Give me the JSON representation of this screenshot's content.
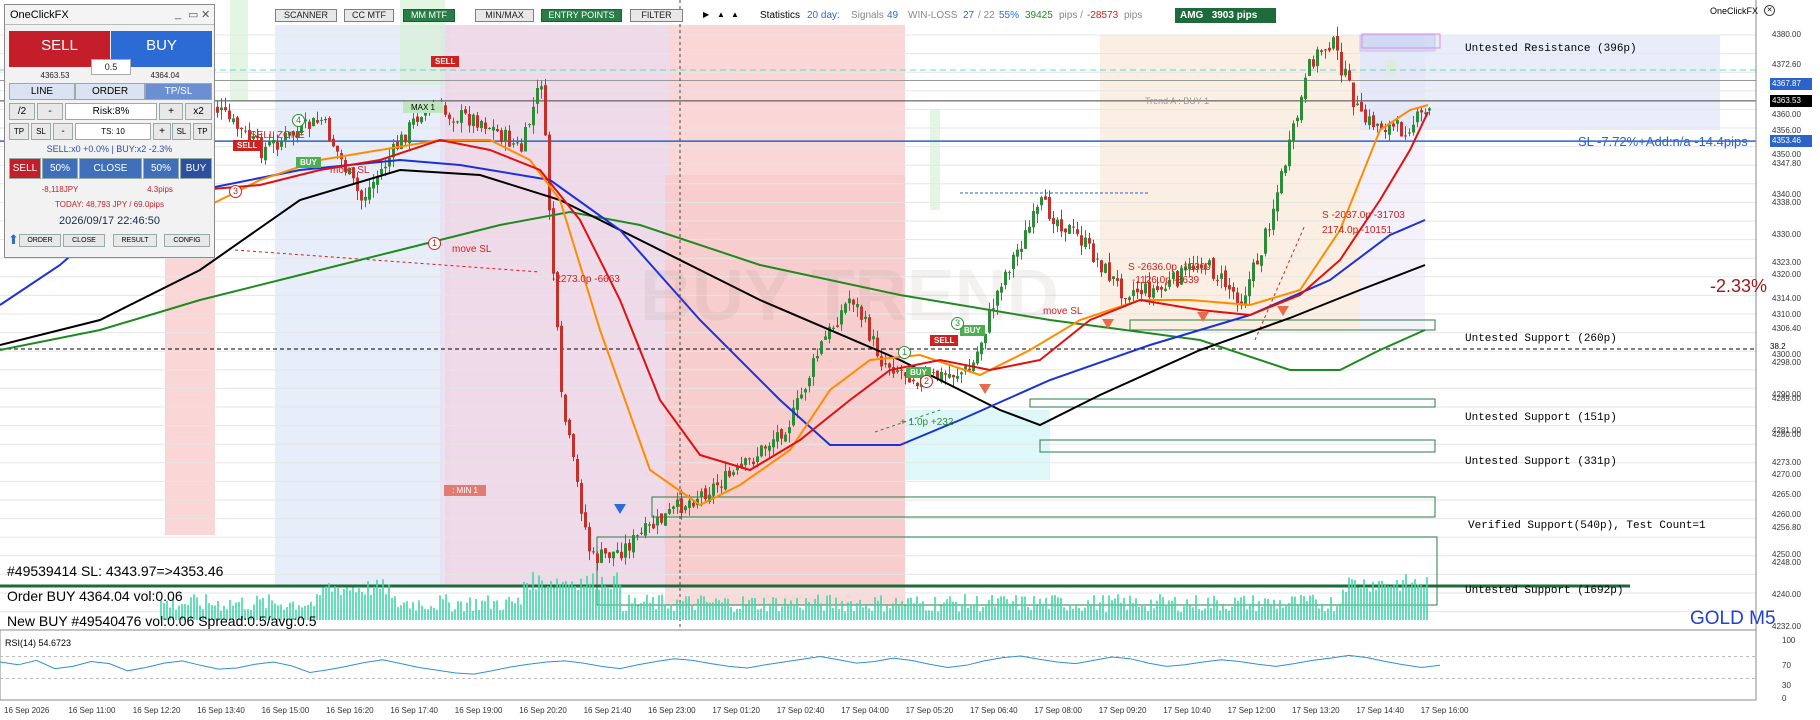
{
  "toolbar": {
    "buttons": [
      {
        "label": "SCANNER",
        "active": false
      },
      {
        "label": "CC MTF",
        "active": false
      },
      {
        "label": "MM MTF",
        "active": true
      },
      {
        "label": "MIN/MAX",
        "active": false
      },
      {
        "label": "ENTRY POINTS",
        "active": true
      },
      {
        "label": "FILTER",
        "active": false
      }
    ],
    "arrows": [
      "▶",
      "▲",
      "▲"
    ]
  },
  "stats": {
    "label": "Statistics",
    "days": "20 day:",
    "signals_label": "Signals",
    "signals": "49",
    "winloss_label": "WIN-LOSS",
    "win": "27",
    "loss": "/ 22",
    "pct": "55%",
    "pips_pos": "39425",
    "pips_label": "pips /",
    "pips_neg": "-28573",
    "pips_label2": "pips",
    "amg_label": "AMG",
    "amg_value": "3903 pips"
  },
  "brand": "OneClickFX",
  "panel": {
    "title": "OneClickFX",
    "controls": [
      "_",
      "▭",
      "✕"
    ],
    "sell_label": "SELL",
    "buy_label": "BUY",
    "spread": "0.5",
    "bid": "4363.53",
    "ask": "4364.04",
    "tabs": [
      "LINE",
      "ORDER",
      "TP/SL"
    ],
    "row1": [
      "/2",
      "-",
      "Risk:8%",
      "+",
      "x2"
    ],
    "row2": [
      "TP",
      "SL",
      "-",
      "TS: 10",
      "+",
      "SL",
      "TP"
    ],
    "position_info": "SELL:x0 +0.0% | BUY:x2 -2.3%",
    "close_row": [
      "SELL",
      "50%",
      "CLOSE",
      "50%",
      "BUY"
    ],
    "pnl_left": "-8,118JPY",
    "pnl_right": "4.3pips",
    "today": "TODAY: 48,793 JPY / 69.0pips",
    "datetime": "2026/09/17   22:46:50",
    "bottom_buttons": [
      "ORDER",
      "CLOSE",
      "RESULT",
      "CONFIG"
    ]
  },
  "zones": [
    {
      "label": "Untested Resistance (396p)"
    },
    {
      "label": "Untested Support (260p)"
    },
    {
      "label": "Untested Support (151p)"
    },
    {
      "label": "Untested Support (331p)"
    },
    {
      "label": "Verified Support(540p), Test Count=1"
    },
    {
      "label": "Untested Support (1692p)"
    }
  ],
  "annotations": {
    "sl_line": "SL -7.72%+Add:n/a -14.4pips",
    "pct_change": "-2.33%",
    "trend_text": "BUY TREND",
    "trend_line": "Trend A : BUY 1",
    "fib": "38.2",
    "max_label": "MAX 1",
    "min_label": ": MIN 1",
    "sell_zone": "SELL ZONE",
    "move_sl": "move SL",
    "move_sl_2": "move SL",
    "move_sl_3": "move SL",
    "trade1": "-2273.0p -6663",
    "trade2_a": "S -2636.0p -12309",
    "trade2_b": "-1126.0p -3639",
    "trade3_a": "S -2037.0p -31703",
    "trade3_b": "2174.0p -10151",
    "trade4": "+ 1.0p +232",
    "signals": [
      {
        "text": "SELL",
        "type": "sell"
      },
      {
        "text": "SELL",
        "type": "sell"
      },
      {
        "text": "BUY",
        "type": "buy"
      },
      {
        "text": "BUY",
        "type": "buy"
      },
      {
        "text": "BUY",
        "type": "buy"
      },
      {
        "text": "SELL",
        "type": "sell"
      }
    ],
    "circles": [
      "4",
      "3",
      "1",
      "1",
      "2",
      "3"
    ]
  },
  "messages": {
    "line1": "#49539414 SL: 4343.97=>4353.46",
    "line2": "Order BUY 4364.04 vol:0.06",
    "line3": "New BUY #49540476 vol:0.06 Spread:0.5/avg:0.5"
  },
  "symbol": "GOLD M5",
  "rsi": {
    "label": "RSI(14) 54.6723",
    "levels": [
      "100",
      "70",
      "30",
      "0"
    ],
    "values": [
      60,
      55,
      63,
      48,
      52,
      61,
      57,
      44,
      50,
      58,
      62,
      54,
      47,
      49,
      56,
      60,
      53,
      41,
      46,
      52,
      59,
      64,
      57,
      50,
      45,
      40,
      38,
      44,
      51,
      56,
      60,
      62,
      58,
      52,
      48,
      55,
      61,
      66,
      63,
      57,
      52,
      49,
      55,
      60,
      65,
      70,
      64,
      58,
      61,
      67,
      63,
      56,
      50,
      54,
      62,
      68,
      71,
      65,
      60,
      57,
      63,
      69,
      66,
      58,
      52,
      55,
      60,
      64,
      61,
      56,
      52,
      57,
      63,
      67,
      72,
      68,
      61,
      55,
      50,
      54
    ]
  },
  "price_axis": {
    "labels": [
      "4380.00",
      "4372.60",
      "4367.87",
      "4363.53",
      "4360.00",
      "4356.00",
      "4353.46",
      "4350.00",
      "4347.80",
      "4340.00",
      "4338.00",
      "4330.00",
      "4323.00",
      "4320.00",
      "4314.00",
      "4310.00",
      "4306.40",
      "4300.00",
      "4298.00",
      "4290.00",
      "4289.00",
      "4281.00",
      "4280.00",
      "4273.00",
      "4270.00",
      "4265.00",
      "4260.00",
      "4256.80",
      "4250.00",
      "4248.00",
      "4240.00",
      "4232.00"
    ],
    "highlights": [
      {
        "label": "4367.87",
        "color": "#2b63c9"
      },
      {
        "label": "4363.53",
        "color": "#000000"
      },
      {
        "label": "4353.46",
        "color": "#2b63c9"
      }
    ]
  },
  "time_axis": {
    "labels": [
      "16 Sep 2026",
      "16 Sep 11:00",
      "16 Sep 12:20",
      "16 Sep 13:40",
      "16 Sep 15:00",
      "16 Sep 16:20",
      "16 Sep 17:40",
      "16 Sep 19:00",
      "16 Sep 20:20",
      "16 Sep 21:40",
      "16 Sep 23:00",
      "17 Sep 01:20",
      "17 Sep 02:40",
      "17 Sep 04:00",
      "17 Sep 05:20",
      "17 Sep 06:40",
      "17 Sep 08:00",
      "17 Sep 09:20",
      "17 Sep 10:40",
      "17 Sep 12:00",
      "17 Sep 13:20",
      "17 Sep 14:40",
      "17 Sep 16:00"
    ]
  },
  "colors": {
    "sell": "#c41e2a",
    "buy": "#2c6ad6",
    "toolbar_active": "#2a7d46",
    "sl_line": "#2b63c9",
    "resistance": "#c0c9ef",
    "support": "#2a7d46",
    "candle_up": "#2e8b3a",
    "candle_down": "#c6302a",
    "ma_red": "#e01010",
    "ma_orange": "#ff8c00",
    "ma_blue": "#1a32d8",
    "ma_black": "#000000",
    "ma_green": "#1f8a1f",
    "volume": "#3fd7a5"
  }
}
